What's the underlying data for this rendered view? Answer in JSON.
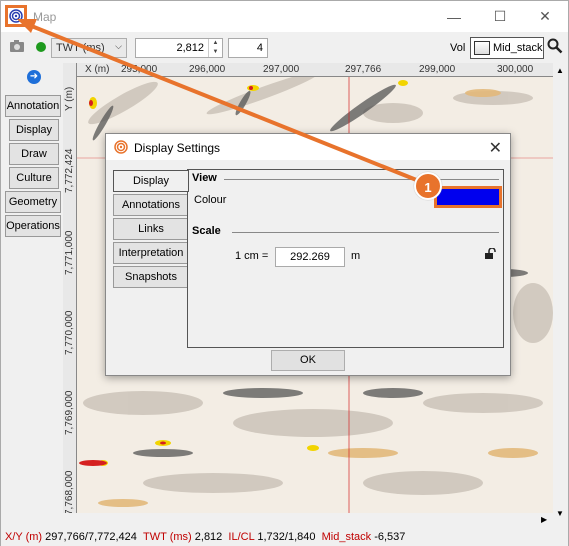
{
  "window": {
    "title": "Map",
    "minimize_icon": "minimize-icon",
    "maximize_icon": "maximize-icon",
    "close_icon": "close-icon"
  },
  "toolbar": {
    "domain_combo": "TWT (ms)",
    "time_value": "2,812",
    "step_value": "4",
    "vol_label": "Vol",
    "volume_name": "Mid_stack"
  },
  "side_tabs": [
    "Annotation",
    "Display",
    "Draw",
    "Culture",
    "Geometry",
    "Operations"
  ],
  "map": {
    "x_axis_label": "X (m)",
    "y_axis_label": "Y (m)",
    "x_ticks": [
      "295,000",
      "296,000",
      "297,000",
      "297,766",
      "299,000",
      "300,000"
    ],
    "y_ticks": [
      "7,772,424",
      "7,771,000",
      "7,770,000",
      "7,769,000",
      "7,768,000"
    ]
  },
  "dialog": {
    "title": "Display Settings",
    "tabs": [
      "Display",
      "Annotations",
      "Links",
      "Interpretation",
      "Snapshots"
    ],
    "view_header": "View",
    "colour_label": "Colour",
    "colour_value": "#0000ee",
    "scale_header": "Scale",
    "scale_prefix": "1 cm  =",
    "scale_value": "292.269",
    "scale_unit": "m",
    "ok_label": "OK"
  },
  "callout": {
    "number": "1",
    "accent": "#e8732c"
  },
  "status": {
    "xy_label": "X/Y (m)",
    "xy_value": "297,766/7,772,424",
    "twt_label": "TWT (ms)",
    "twt_value": "2,812",
    "ilcl_label": "IL/CL",
    "ilcl_value": "1,732/1,840",
    "vol_label": "Mid_stack",
    "vol_value": "-6,537"
  }
}
